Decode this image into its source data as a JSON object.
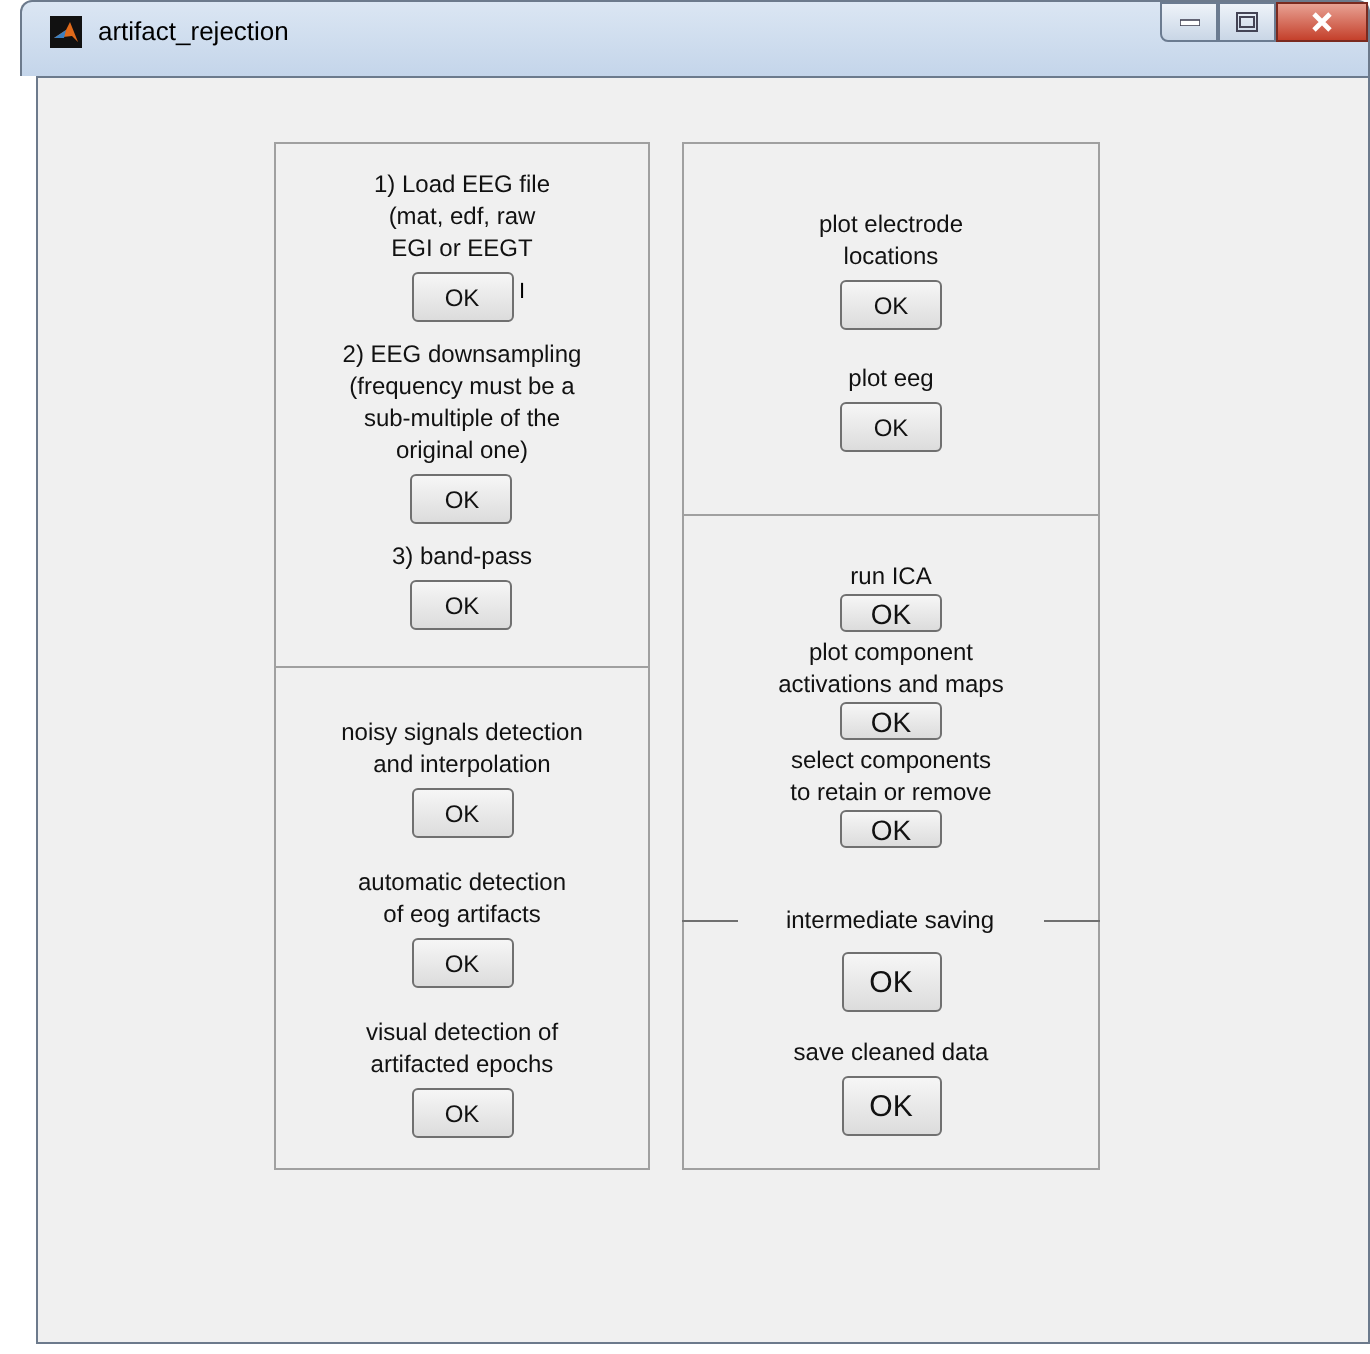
{
  "window": {
    "title": "artifact_rejection"
  },
  "columns": [
    {
      "panels": [
        {
          "items": [
            {
              "kind": "small",
              "label": "1) Load EEG file\n(mat, edf, raw\nEGI or EEGT",
              "button": "OK",
              "fragment": "I"
            },
            {
              "kind": "small",
              "label": "2) EEG downsampling\n(frequency must be a\nsub-multiple of the\noriginal one)",
              "button": "OK"
            },
            {
              "kind": "small",
              "label": "3) band-pass",
              "button": "OK"
            }
          ]
        },
        {
          "items": [
            {
              "kind": "small",
              "label": "noisy signals detection\nand interpolation",
              "button": "OK"
            },
            {
              "kind": "small",
              "label": "automatic detection\nof eog artifacts",
              "button": "OK"
            },
            {
              "kind": "small",
              "label": "visual detection of\nartifacted epochs",
              "button": "OK"
            }
          ]
        }
      ]
    },
    {
      "panels": [
        {
          "items": [
            {
              "kind": "small",
              "label": "plot electrode\nlocations",
              "button": "OK"
            },
            {
              "kind": "small",
              "label": "plot eeg",
              "button": "OK"
            }
          ]
        },
        {
          "items": [
            {
              "kind": "tight",
              "label": "run ICA",
              "button": "OK"
            },
            {
              "kind": "tight",
              "label": "plot component\nactivations and maps",
              "button": "OK"
            },
            {
              "kind": "tight",
              "label": "select components\nto retain or remove",
              "button": "OK"
            },
            {
              "kind": "divider",
              "label": "intermediate saving",
              "button": "OK"
            },
            {
              "kind": "large",
              "label": "save cleaned data",
              "button": "OK"
            }
          ]
        }
      ]
    }
  ]
}
